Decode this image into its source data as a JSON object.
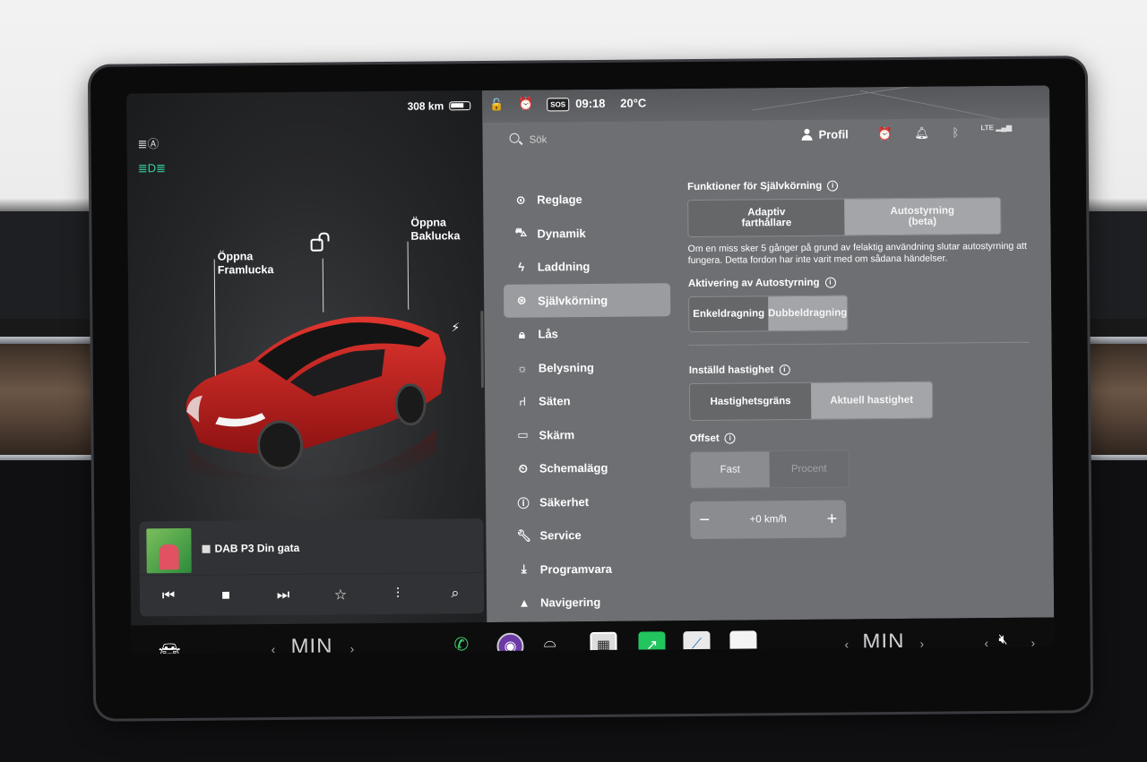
{
  "status": {
    "range": "308 km",
    "time": "09:18",
    "temperature": "20°C",
    "sos": "SOS"
  },
  "car": {
    "front_trunk": "Öppna\nFramlucka",
    "front_trunk_line1": "Öppna",
    "front_trunk_line2": "Framlucka",
    "rear_trunk_line1": "Öppna",
    "rear_trunk_line2": "Baklucka"
  },
  "media": {
    "station": "DAB P3 Din gata"
  },
  "settings": {
    "search_placeholder": "Sök",
    "profile_label": "Profil",
    "nav": [
      {
        "label": "Reglage",
        "icon": "toggle-icon"
      },
      {
        "label": "Dynamik",
        "icon": "car-icon"
      },
      {
        "label": "Laddning",
        "icon": "bolt-icon"
      },
      {
        "label": "Självkörning",
        "icon": "steering-wheel-icon",
        "active": true
      },
      {
        "label": "Lås",
        "icon": "lock-icon"
      },
      {
        "label": "Belysning",
        "icon": "sun-icon"
      },
      {
        "label": "Säten",
        "icon": "seat-icon"
      },
      {
        "label": "Skärm",
        "icon": "display-icon"
      },
      {
        "label": "Schemalägg",
        "icon": "alarm-clock-icon"
      },
      {
        "label": "Säkerhet",
        "icon": "info-icon"
      },
      {
        "label": "Service",
        "icon": "wrench-icon"
      },
      {
        "label": "Programvara",
        "icon": "download-icon"
      },
      {
        "label": "Navigering",
        "icon": "navigation-icon"
      }
    ],
    "autopilot_title": "Funktioner för Självkörning",
    "autopilot_options": [
      "Adaptiv\nfarthållare",
      "Autostyrning\n(beta)"
    ],
    "autopilot_opt1_line1": "Adaptiv",
    "autopilot_opt1_line2": "farthållare",
    "autopilot_opt2_line1": "Autostyrning",
    "autopilot_opt2_line2": "(beta)",
    "autopilot_desc": "Om en miss sker 5 gånger på grund av felaktig användning slutar autostyrning att fungera. Detta fordon har inte varit med om sådana händelser.",
    "activation_title": "Aktivering av Autostyrning",
    "activation_opt1": "Enkeldragning",
    "activation_opt2": "Dubbeldragning",
    "speed_title": "Inställd hastighet",
    "speed_opt1": "Hastighetsgräns",
    "speed_opt2": "Aktuell hastighet",
    "offset_title": "Offset",
    "offset_opt1": "Fast",
    "offset_opt2": "Procent",
    "offset_value": "+0 km/h"
  },
  "taskbar": {
    "left_temp": "MIN",
    "right_temp": "MIN"
  },
  "colors": {
    "accent_alarm": "#f4c21a",
    "headlight_green": "#38d39f",
    "car_red": "#c8201f"
  }
}
